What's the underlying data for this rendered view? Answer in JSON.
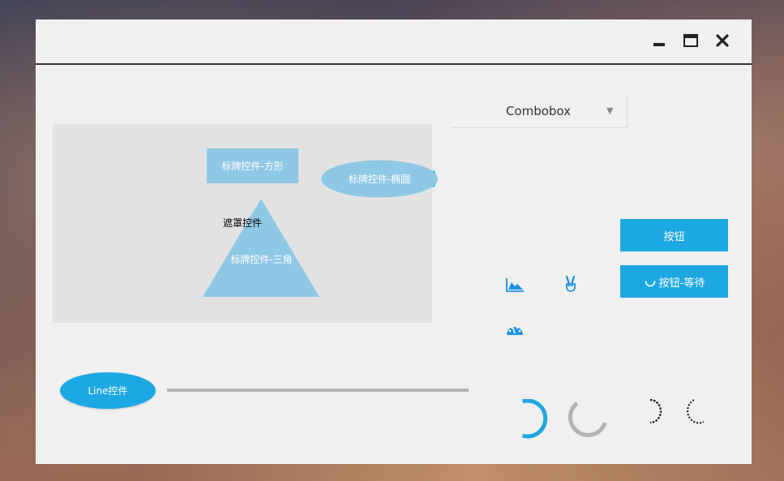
{
  "window": {
    "controls": {
      "minimize": "minimize-icon",
      "maximize": "maximize-icon",
      "close": "close-icon"
    }
  },
  "canvas": {
    "sign_rect_label": "标牌控件-方形",
    "sign_ellipse_label": "标牌控件-椭圆",
    "mask_label": "遮罩控件",
    "sign_triangle_label": "标牌控件-三角"
  },
  "combobox": {
    "value": "Combobox",
    "arrow": "▼"
  },
  "buttons": {
    "primary_label": "按钮",
    "waiting_label": "按钮-等待"
  },
  "icons": [
    "area-chart-icon",
    "peace-hand-icon",
    "dashboard-gauge-icon"
  ],
  "line_control": {
    "label": "Line控件"
  },
  "colors": {
    "accent": "#1ea8e3",
    "sign_fill": "#8fc8e5",
    "panel": "#e2e2e2",
    "window": "#f0f0f0"
  }
}
